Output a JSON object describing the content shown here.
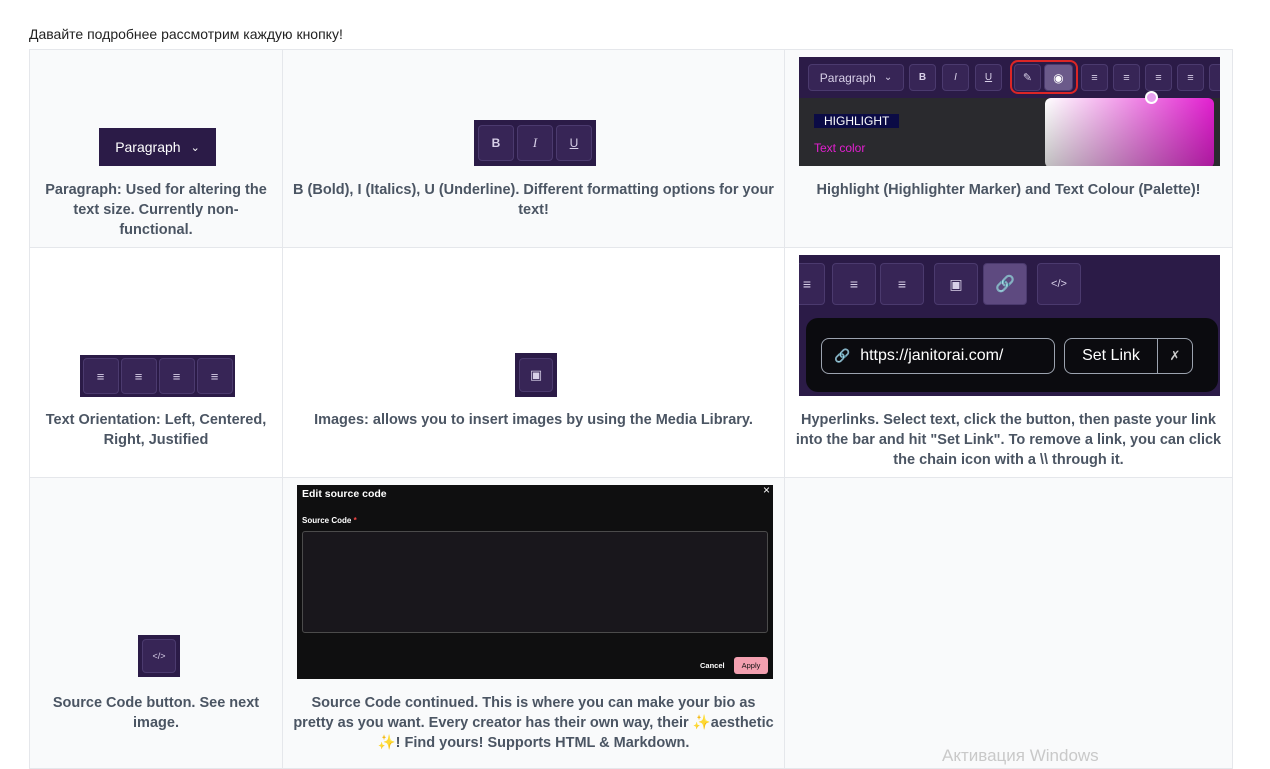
{
  "intro": "Давайте подробнее рассмотрим каждую кнопку!",
  "cells": {
    "paragraph": {
      "button_label": "Paragraph",
      "caption": "Paragraph: Used for altering the text size. Currently non-functional."
    },
    "formatting": {
      "bold": "B",
      "italic": "I",
      "underline": "U",
      "caption": "B (Bold), I (Italics), U (Underline). Different formatting options for your text!"
    },
    "highlight": {
      "toolbar_paragraph": "Paragraph",
      "highlight_sample": "HIGHLIGHT",
      "text_color_sample": "Text color",
      "caption": "Highlight (Highlighter Marker) and Text Colour (Palette)!"
    },
    "orientation": {
      "caption": "Text Orientation: Left, Centered, Right, Justified"
    },
    "images": {
      "caption": "Images: allows you to insert images by using the Media Library."
    },
    "hyperlinks": {
      "url": "https://janitorai.com/",
      "set_link": "Set Link",
      "caption": "Hyperlinks. Select text, click the button, then paste your link into the bar and hit \"Set Link\". To remove a link, you can click the chain icon with a \\\\ through it."
    },
    "source_code": {
      "caption": "Source Code button. See next image."
    },
    "source_editor": {
      "dialog_title": "Edit source code",
      "field_label": "Source Code",
      "required_mark": "*",
      "cancel": "Cancel",
      "apply": "Apply",
      "caption_line1": "Source Code continued. This is where you can make your bio as pretty as you want. Every creator has their own way, their",
      "caption_line2": "aesthetic",
      "caption_line3": "! Find yours! Supports HTML & Markdown."
    }
  },
  "watermark": "Активация Windows",
  "colors": {
    "toolbar_dark": "#2b1b47",
    "button_bg": "#372556",
    "highlight_ring": "#dc2626",
    "picker_magenta": "#e21fd0",
    "apply_pink": "#f3a0b0"
  }
}
